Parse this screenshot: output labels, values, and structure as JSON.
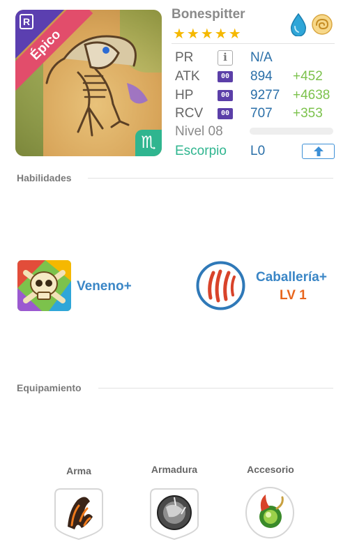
{
  "creature": {
    "name": "Bonespitter",
    "rarity_label": "Épico",
    "rarity_badge": "R",
    "stars": "★★★★★",
    "zodiac_symbol": "♏",
    "elements": [
      "water-drop-icon",
      "cloud-swirl-icon"
    ]
  },
  "stats": {
    "pr": {
      "label": "PR",
      "value": "N/A",
      "info": "i"
    },
    "atk": {
      "label": "ATK",
      "chip": "00",
      "value": "894",
      "bonus": "+452"
    },
    "hp": {
      "label": "HP",
      "chip": "00",
      "value": "9277",
      "bonus": "+4638"
    },
    "rcv": {
      "label": "RCV",
      "chip": "00",
      "value": "707",
      "bonus": "+353"
    },
    "level": {
      "label": "Nivel 08",
      "progress": 0
    },
    "sign": {
      "label": "Escorpio",
      "value": "L0"
    }
  },
  "skills": {
    "title": "Habilidades",
    "items": [
      {
        "name": "Veneno+",
        "icon": "poison-skull-icon"
      },
      {
        "name": "Caballería+",
        "level": "LV 1",
        "icon": "claw-slash-icon"
      }
    ]
  },
  "equipment": {
    "title": "Equipamiento",
    "slots": [
      {
        "label": "Arma",
        "icon": "lava-claw-icon"
      },
      {
        "label": "Armadura",
        "icon": "shield-orb-icon"
      },
      {
        "label": "Accesorio",
        "icon": "green-orb-icon"
      }
    ]
  },
  "colors": {
    "accent_blue": "#3a86c6",
    "bonus_green": "#7cc24c",
    "level_orange": "#e8661e",
    "epic_ribbon": "#e24d6b",
    "zodiac_green": "#2fb58f"
  }
}
